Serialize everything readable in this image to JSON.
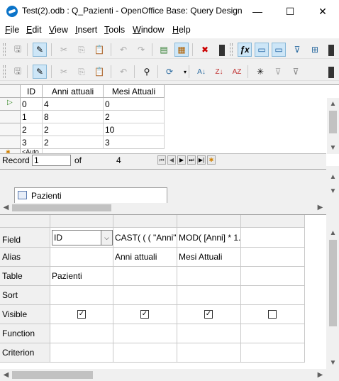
{
  "window": {
    "title": "Test(2).odb : Q_Pazienti - OpenOffice Base: Query Design",
    "minimize": "—",
    "maximize": "☐",
    "close": "✕"
  },
  "menu": [
    {
      "label": "File",
      "u": "F",
      "rest": "ile"
    },
    {
      "label": "Edit",
      "u": "E",
      "rest": "dit"
    },
    {
      "label": "View",
      "u": "V",
      "rest": "iew"
    },
    {
      "label": "Insert",
      "u": "I",
      "rest": "nsert"
    },
    {
      "label": "Tools",
      "u": "T",
      "rest": "ools"
    },
    {
      "label": "Window",
      "u": "W",
      "rest": "indow"
    },
    {
      "label": "Help",
      "u": "H",
      "rest": "elp"
    }
  ],
  "grid": {
    "columns": [
      "ID",
      "Anni attuali",
      "Mesi Attuali"
    ],
    "rows": [
      [
        "0",
        "4",
        "0"
      ],
      [
        "1",
        "8",
        "2"
      ],
      [
        "2",
        "2",
        "10"
      ],
      [
        "3",
        "2",
        "3"
      ]
    ],
    "autofield_partial": "<Auto"
  },
  "recordbar": {
    "record_label": "Record",
    "record_value": "1",
    "of_label": "of",
    "total": "4"
  },
  "relation": {
    "table_name": "Pazienti"
  },
  "design": {
    "row_labels": [
      "Field",
      "Alias",
      "Table",
      "Sort",
      "Visible",
      "Function",
      "Criterion"
    ],
    "columns": [
      {
        "field": "ID",
        "alias": "",
        "table": "Pazienti",
        "visible": true
      },
      {
        "field": "CAST( ( ( \"Anni\"",
        "alias": "Anni attuali",
        "table": "",
        "visible": true
      },
      {
        "field": "MOD( [Anni] * 1.",
        "alias": "Mesi Attuali",
        "table": "",
        "visible": true
      },
      {
        "field": "",
        "alias": "",
        "table": "",
        "visible": false
      }
    ]
  },
  "colors": {
    "accent_blue": "#0b74c9",
    "toolbar_active": "#cde6f7"
  }
}
